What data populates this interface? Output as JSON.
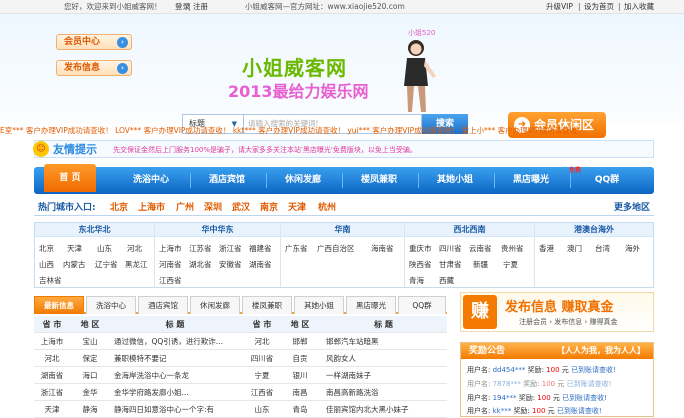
{
  "topbar": {
    "welcome": "您好，欢迎来到小姐威客网！",
    "login": "登录",
    "sep": "|",
    "register": "注册",
    "official": "小姐威客网—官方网址：www.xiaojie520.com",
    "upgrade": "升级VIP",
    "set_home": "设为首页",
    "favorite": "加入收藏"
  },
  "header": {
    "user_center": "会员中心",
    "post_info": "发布信息",
    "logo_main": "小姐威客网",
    "logo_sub": "2013最给力娱乐网",
    "logo_tag": "小姐520",
    "search_select": "标题",
    "search_placeholder": "请输入搜索的关键词!",
    "search_button": "搜索",
    "vip_button": "会员休闲区"
  },
  "ticker": "E室*** 客户办理VIP成功请查收！  LOV*** 客户办理VIP成功请查收！  kkt*** 客户办理VIP成功请查收！  yui*** 客户办理VIP成功请查收！  爱上小*** 客户办理VIP成功请查收！",
  "tip": {
    "title": "友情提示",
    "text": "先交保证金然后上门服务100%是骗子，请大家多多关注本站'黑店曝光'免费版块，以免上当受骗。"
  },
  "nav": {
    "items": [
      "首 页",
      "洗浴中心",
      "酒店宾馆",
      "休闲发廊",
      "楼凤兼职",
      "其她小姐",
      "黑店曝光",
      "QQ群"
    ],
    "hot_badge": "免费"
  },
  "cities": {
    "label": "热门城市入口:",
    "items": [
      "北京",
      "上海市",
      "广州",
      "深圳",
      "武汉",
      "南京",
      "天津",
      "杭州"
    ],
    "more": "更多地区"
  },
  "regions": [
    {
      "name": "东北华北",
      "provinces": [
        "北京",
        "天津",
        "山东",
        "河北",
        "山西",
        "内蒙古",
        "辽宁省",
        "黑龙江",
        "吉林省"
      ]
    },
    {
      "name": "华中华东",
      "provinces": [
        "上海市",
        "江苏省",
        "浙江省",
        "福建省",
        "河南省",
        "湖北省",
        "安徽省",
        "湖南省",
        "江西省"
      ]
    },
    {
      "name": "华南",
      "provinces": [
        "广东省",
        "广西自治区",
        "海南省"
      ]
    },
    {
      "name": "西北西南",
      "provinces": [
        "重庆市",
        "四川省",
        "云南省",
        "贵州省",
        "陕西省",
        "甘肃省",
        "新疆",
        "宁夏",
        "青海",
        "西藏"
      ]
    },
    {
      "name": "港澳台海外",
      "provinces": [
        "香港",
        "澳门",
        "台湾",
        "海外"
      ]
    }
  ],
  "tabs": [
    "最新信息",
    "洗浴中心",
    "酒店宾馆",
    "休闲发廊",
    "楼凤兼职",
    "其她小姐",
    "黑店曝光",
    "QQ群"
  ],
  "table": {
    "headers": [
      "省 市",
      "地 区",
      "标 题",
      "省 市",
      "地 区",
      "标 题"
    ],
    "rows": [
      [
        "上海市",
        "宝山",
        "通过微信，QQ引诱，进行欺诈...",
        "河北",
        "邯郸",
        "邯郸汽车站暗黑"
      ],
      [
        "河北",
        "保定",
        "兼职模特不要记",
        "四川省",
        "自贡",
        "风韵女人"
      ],
      [
        "湖南省",
        "海口",
        "金海岸洗浴中心一条龙",
        "宁夏",
        "银川",
        "一样湖南妹子"
      ],
      [
        "浙江省",
        "金华",
        "金华学府路发廊小姐...",
        "江西省",
        "南昌",
        "南昌高新路洗浴"
      ],
      [
        "天津",
        "静海",
        "静海四日如意浴中心一个字:有",
        "山东",
        "青岛",
        "佳丽宾馆内北大黑小妹子"
      ]
    ]
  },
  "side": {
    "icon_text": "赚",
    "title": "发布信息  赚取真金",
    "subtitle": "注册会员 › 发布信息 › 赚得真金"
  },
  "award": {
    "title": "奖励公告",
    "slogan": "【人人为我，我为人人】",
    "lines": [
      {
        "prefix": "用户名:",
        "user": "dd454***",
        "mid": "奖励:",
        "amount": "100",
        "suffix": "元",
        "status": "已到账请查收!"
      },
      {
        "prefix": "用户名:",
        "user": "7878***",
        "mid": "奖励:",
        "amount": "100",
        "suffix": "元",
        "status": "已到账请查收!"
      },
      {
        "prefix": "用户名:",
        "user": "194***",
        "mid": "奖励:",
        "amount": "100",
        "suffix": "元",
        "status": "已到账请查收!"
      },
      {
        "prefix": "用户名:",
        "user": "kk***",
        "mid": "奖励:",
        "amount": "100",
        "suffix": "元",
        "status": "已到账请查收!"
      }
    ]
  },
  "colors": {
    "accent": "#f07000",
    "nav_blue": "#0c65c4",
    "link_blue": "#1a5aa6",
    "logo_green": "#6ab800",
    "logo_pink": "#e75fd0"
  }
}
